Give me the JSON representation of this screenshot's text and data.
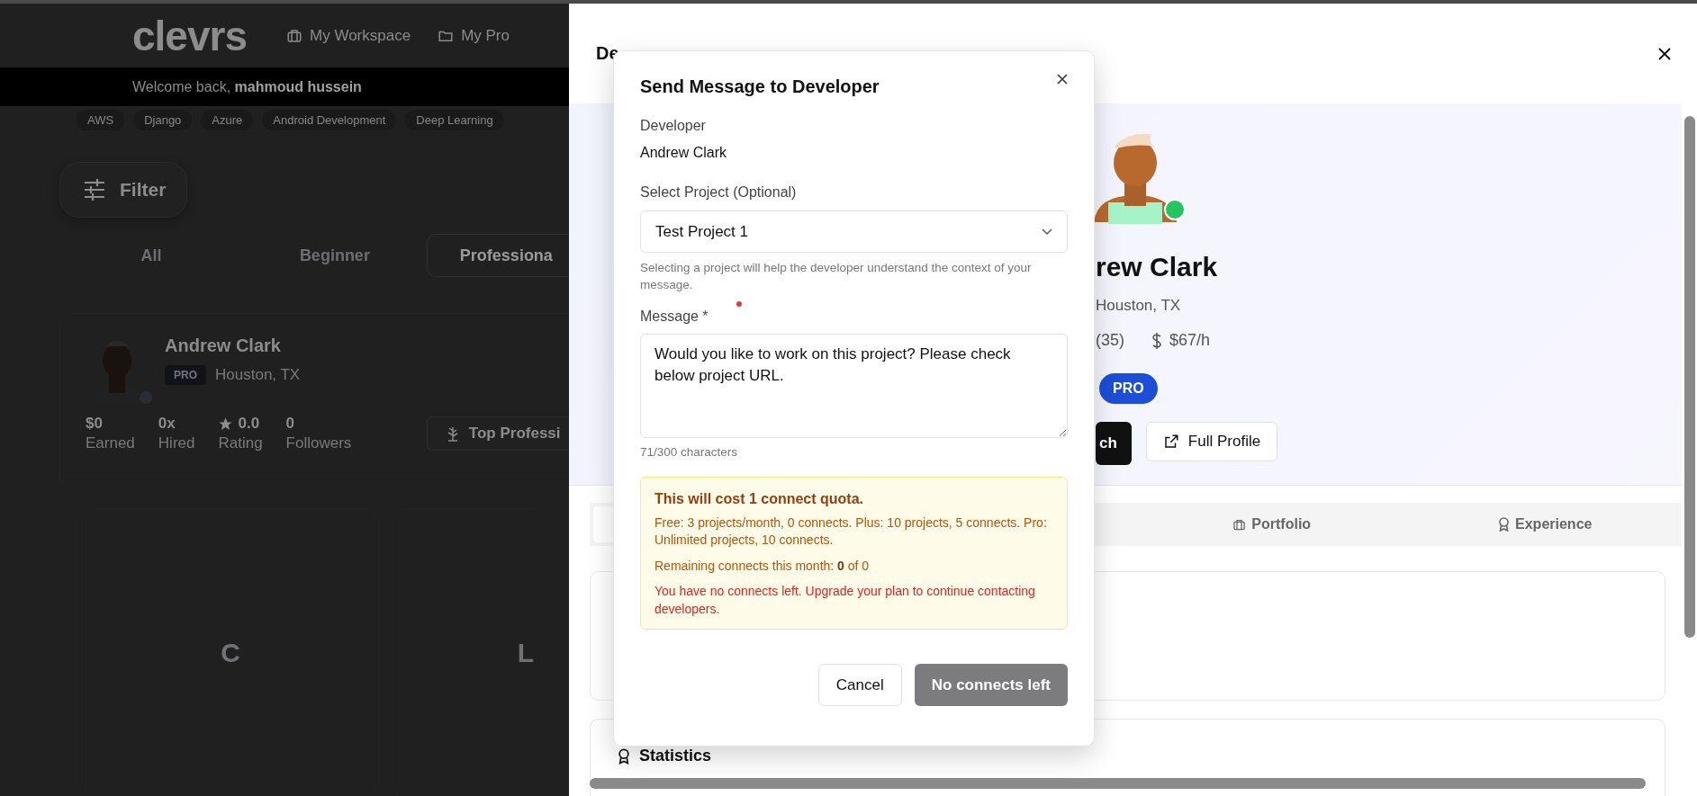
{
  "background_page": {
    "logo": "clevrs",
    "nav": [
      "My Workspace",
      "My Pro"
    ],
    "welcome": "Welcome back, **mahmoud hussein**",
    "tags": [
      "AWS",
      "Django",
      "Azure",
      "Android Development",
      "Deep Learning"
    ],
    "filter_button": "Filter",
    "level_tabs": [
      {
        "label": "All",
        "selected": false
      },
      {
        "label": "Beginner",
        "selected": false
      },
      {
        "label": "Professiona",
        "selected": true
      }
    ],
    "developer_card": {
      "name": "Andrew Clark",
      "badge": "PRO",
      "location": "Houston, TX",
      "stats": [
        {
          "kind": "plain",
          "value": "$0",
          "label": "Earned"
        },
        {
          "kind": "plain",
          "value": "0x",
          "label": "Hired"
        },
        {
          "kind": "rating",
          "value": "0.0",
          "label": "Rating"
        },
        {
          "kind": "plain",
          "value": "0",
          "label": "Followers"
        }
      ],
      "top_button": "Top Professi"
    },
    "project_cards": [
      {
        "initial": "C"
      },
      {
        "initial": "L"
      }
    ]
  },
  "drawer": {
    "title": "De",
    "name": "rew Clark",
    "location": "Houston, TX",
    "reviews": "(35)",
    "rate": "$67/h",
    "badge": "PRO",
    "online": true,
    "contact_button": "ch",
    "profile_button": "Full Profile",
    "tabs": [
      {
        "selected": true
      },
      {
        "label": "Portfolio",
        "selected": false
      },
      {
        "label": "Experience",
        "selected": false
      }
    ],
    "section_title": "Statistics"
  },
  "modal": {
    "title": "Send Message to Developer",
    "developer_label": "Developer",
    "developer_name": "Andrew Clark",
    "project_label": "Select Project (Optional)",
    "project_value": "Test Project 1",
    "project_hint": "Selecting a project will help the developer understand the context of your message.",
    "message_label": "Message *",
    "message_value": "Would you like to work on this project? Please check below project URL.",
    "char_count": "71/300 characters",
    "quota": {
      "title": "This will cost 1 connect quota.",
      "plans": "Free: 3 projects/month, 0 connects. Plus: 10 projects, 5 connects. Pro: Unlimited projects, 10 connects.",
      "remaining": "Remaining connects this month: **0** of 0",
      "warning": "You have no connects left. Upgrade your plan to continue contacting developers."
    },
    "cancel_button": "Cancel",
    "send_button": {
      "label": "No connects left",
      "disabled": true
    }
  }
}
